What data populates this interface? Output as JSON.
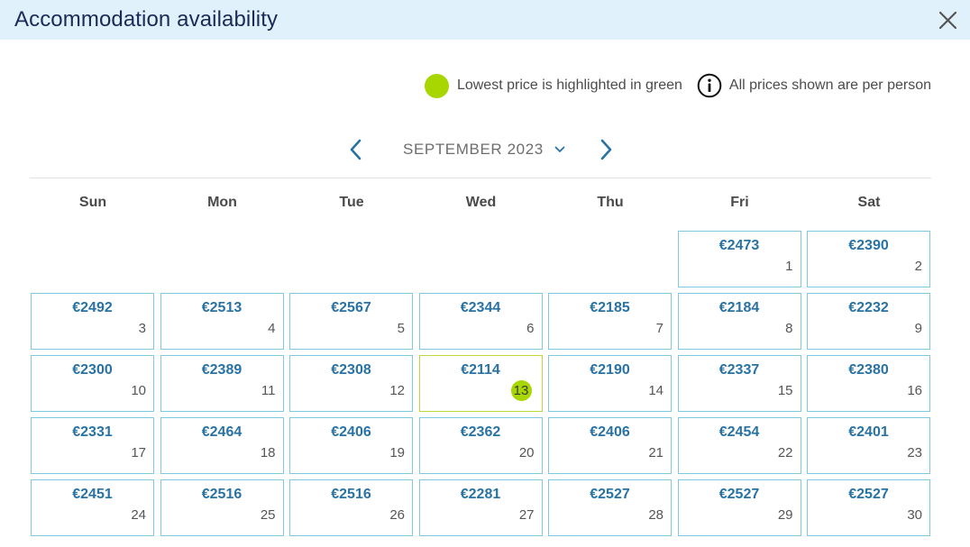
{
  "header": {
    "title": "Accommodation availability"
  },
  "legend": {
    "lowest_text": "Lowest price is highlighted in green",
    "info_text": "All prices shown are per person",
    "lowest_color": "#a8d600"
  },
  "calendar": {
    "month_label": "SEPTEMBER 2023",
    "weekdays": [
      "Sun",
      "Mon",
      "Tue",
      "Wed",
      "Thu",
      "Fri",
      "Sat"
    ],
    "first_weekday_index": 5,
    "lowest_day": 13,
    "days": [
      {
        "day": "1",
        "price": "€2473"
      },
      {
        "day": "2",
        "price": "€2390"
      },
      {
        "day": "3",
        "price": "€2492"
      },
      {
        "day": "4",
        "price": "€2513"
      },
      {
        "day": "5",
        "price": "€2567"
      },
      {
        "day": "6",
        "price": "€2344"
      },
      {
        "day": "7",
        "price": "€2185"
      },
      {
        "day": "8",
        "price": "€2184"
      },
      {
        "day": "9",
        "price": "€2232"
      },
      {
        "day": "10",
        "price": "€2300"
      },
      {
        "day": "11",
        "price": "€2389"
      },
      {
        "day": "12",
        "price": "€2308"
      },
      {
        "day": "13",
        "price": "€2114"
      },
      {
        "day": "14",
        "price": "€2190"
      },
      {
        "day": "15",
        "price": "€2337"
      },
      {
        "day": "16",
        "price": "€2380"
      },
      {
        "day": "17",
        "price": "€2331"
      },
      {
        "day": "18",
        "price": "€2464"
      },
      {
        "day": "19",
        "price": "€2406"
      },
      {
        "day": "20",
        "price": "€2362"
      },
      {
        "day": "21",
        "price": "€2406"
      },
      {
        "day": "22",
        "price": "€2454"
      },
      {
        "day": "23",
        "price": "€2401"
      },
      {
        "day": "24",
        "price": "€2451"
      },
      {
        "day": "25",
        "price": "€2516"
      },
      {
        "day": "26",
        "price": "€2516"
      },
      {
        "day": "27",
        "price": "€2281"
      },
      {
        "day": "28",
        "price": "€2527"
      },
      {
        "day": "29",
        "price": "€2527"
      },
      {
        "day": "30",
        "price": "€2527"
      }
    ]
  },
  "icons": {
    "close": "close-icon",
    "info": "info-icon",
    "prev": "chevron-left-icon",
    "next": "chevron-right-icon",
    "caret": "chevron-down-icon"
  },
  "colors": {
    "header_bg": "#e1f1fb",
    "title": "#1b2a57",
    "accent": "#2873a4",
    "cell_border": "#7ec9de",
    "lowest_border": "#b9d83a"
  }
}
